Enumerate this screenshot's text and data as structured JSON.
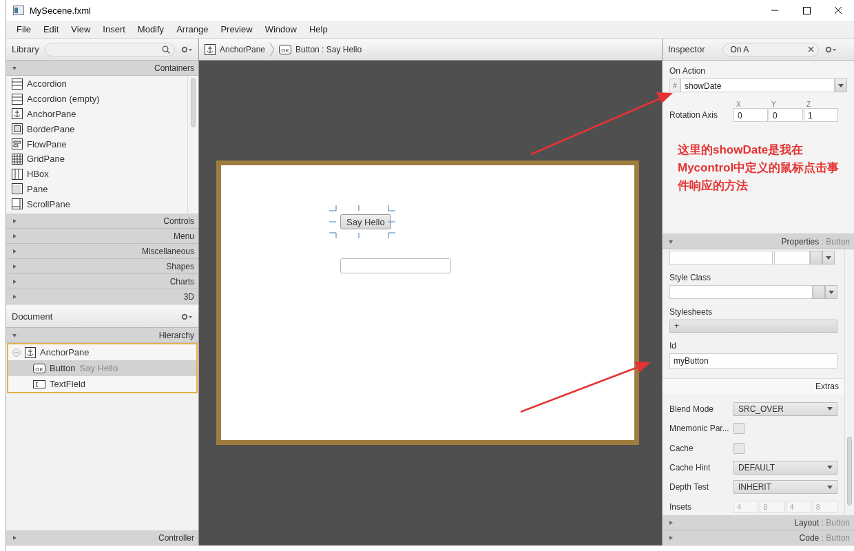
{
  "window": {
    "title": "MySecene.fxml"
  },
  "menu": [
    "File",
    "Edit",
    "View",
    "Insert",
    "Modify",
    "Arrange",
    "Preview",
    "Window",
    "Help"
  ],
  "library": {
    "title": "Library",
    "sections": [
      {
        "label": "Containers",
        "expanded": true,
        "items": [
          {
            "label": "Accordion",
            "kind": "accordion"
          },
          {
            "label": "Accordion  (empty)",
            "kind": "accordion"
          },
          {
            "label": "AnchorPane",
            "kind": "anchor"
          },
          {
            "label": "BorderPane",
            "kind": "border"
          },
          {
            "label": "FlowPane",
            "kind": "flow"
          },
          {
            "label": "GridPane",
            "kind": "grid"
          },
          {
            "label": "HBox",
            "kind": "hbox"
          },
          {
            "label": "Pane",
            "kind": "pane"
          },
          {
            "label": "ScrollPane",
            "kind": "scroll"
          }
        ]
      },
      {
        "label": "Controls",
        "expanded": false
      },
      {
        "label": "Menu",
        "expanded": false
      },
      {
        "label": "Miscellaneous",
        "expanded": false
      },
      {
        "label": "Shapes",
        "expanded": false
      },
      {
        "label": "Charts",
        "expanded": false
      },
      {
        "label": "3D",
        "expanded": false
      }
    ]
  },
  "document": {
    "title": "Document",
    "section": {
      "label": "Hierarchy",
      "expanded": true
    },
    "tree": [
      {
        "label": "AnchorPane",
        "kind": "anchor",
        "expanded": true,
        "selected": false,
        "children": [
          {
            "label": "Button",
            "detail": "Say Hello",
            "kind": "button",
            "badge": "OK",
            "selected": true
          },
          {
            "label": "TextField",
            "kind": "textfield",
            "selected": false
          }
        ]
      }
    ],
    "controller": {
      "label": "Controller",
      "expanded": false
    }
  },
  "breadcrumb": [
    {
      "label": "AnchorPane",
      "kind": "anchor"
    },
    {
      "label": "Button : Say Hello",
      "kind": "button",
      "badge": "OK"
    }
  ],
  "canvas": {
    "button": {
      "label": "Say Hello",
      "selected": true
    }
  },
  "inspector": {
    "title": "Inspector",
    "search": {
      "value": "On A"
    },
    "on_action": {
      "label": "On Action",
      "prefix": "#",
      "value": "showDate"
    },
    "rotation_axis": {
      "label": "Rotation Axis",
      "fields": [
        {
          "axis": "X",
          "value": "0"
        },
        {
          "axis": "Y",
          "value": "0"
        },
        {
          "axis": "Z",
          "value": "1"
        }
      ]
    },
    "annotation": "这里的showDate是我在Mycontrol中定义的鼠标点击事件响应的方法",
    "properties": {
      "label": "Properties",
      "target": ": Button",
      "expanded": true,
      "style_class": {
        "label": "Style Class"
      },
      "stylesheets": {
        "label": "Stylesheets",
        "button": "+"
      },
      "id": {
        "label": "Id",
        "value": "myButton"
      },
      "extras": "Extras",
      "rows": [
        {
          "kind": "select",
          "label": "Blend Mode",
          "value": "SRC_OVER"
        },
        {
          "kind": "checkbox",
          "label": "Mnemonic Par...",
          "checked": false
        },
        {
          "kind": "checkbox",
          "label": "Cache",
          "checked": false
        },
        {
          "kind": "select",
          "label": "Cache Hint",
          "value": "DEFAULT"
        },
        {
          "kind": "select",
          "label": "Depth Test",
          "value": "INHERIT"
        },
        {
          "kind": "insets",
          "label": "Insets",
          "values": [
            "4",
            "8",
            "4",
            "8"
          ]
        }
      ]
    },
    "sections": [
      {
        "label": "Layout",
        "target": ": Button",
        "expanded": false
      },
      {
        "label": "Code",
        "target": ": Button",
        "expanded": false
      }
    ]
  }
}
